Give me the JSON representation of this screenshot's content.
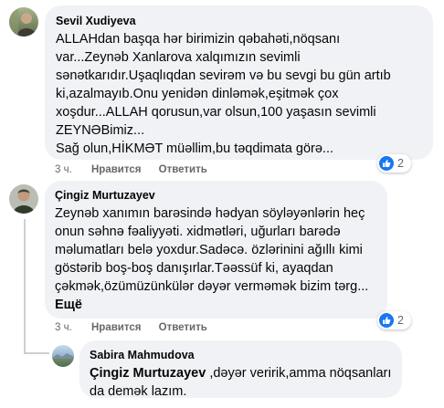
{
  "colors": {
    "bubble": "#f0f2f5",
    "meta": "#65676b",
    "like": "#1877f2"
  },
  "comments": [
    {
      "author": "Sevil Xudiyeva",
      "lines": [
        "ALLAHdan başqa hər birimizin qəbahəti,nöqsanı",
        "var...Zeynəb Xanlarova xalqımızın sevimli",
        "sənətkarıdır.Uşaqlıqdan sevirəm və bu sevgi bu gün artıb",
        "ki,azalmayıb.Onu yenidən dinləmək,eşitmək çox",
        "xoşdur...ALLAH qorusun,var olsun,100 yaşasın sevimli",
        "ZEYNƏBimiz...",
        "Sağ olun,HİKMƏT müəllim,bu təqdimata görə..."
      ],
      "time": "3 ч.",
      "like_label": "Нравится",
      "reply_label": "Ответить",
      "reaction_count": "2",
      "reaction_icon": "thumbs-up-icon"
    },
    {
      "author": "Çingiz Murtuzayev",
      "lines": [
        "Zeynəb xanımın barəsində hədyan söyləyənlərin heç",
        "onun səhnə fəaliyyəti. xidmətləri, uğurları barədə",
        "məlumatları belə yoxdur.Sadəcə. özlərinini ağıllı kimi",
        "göstərib boş-boş danışırlar.Təəssüf ki, ayaqdan",
        "çəkmək,özümüzünkülər dəyər verməmək bizim tərg..."
      ],
      "more_label": "Ещё",
      "time": "3 ч.",
      "like_label": "Нравится",
      "reply_label": "Ответить",
      "reaction_count": "2",
      "reaction_icon": "thumbs-up-icon"
    }
  ],
  "reply": {
    "author": "Sabira Mahmudova",
    "mention": "Çingiz Murtuzayev",
    "line1_rest": " ,dəyər veririk,amma nöqsanları",
    "line2": "da demək lazım."
  }
}
